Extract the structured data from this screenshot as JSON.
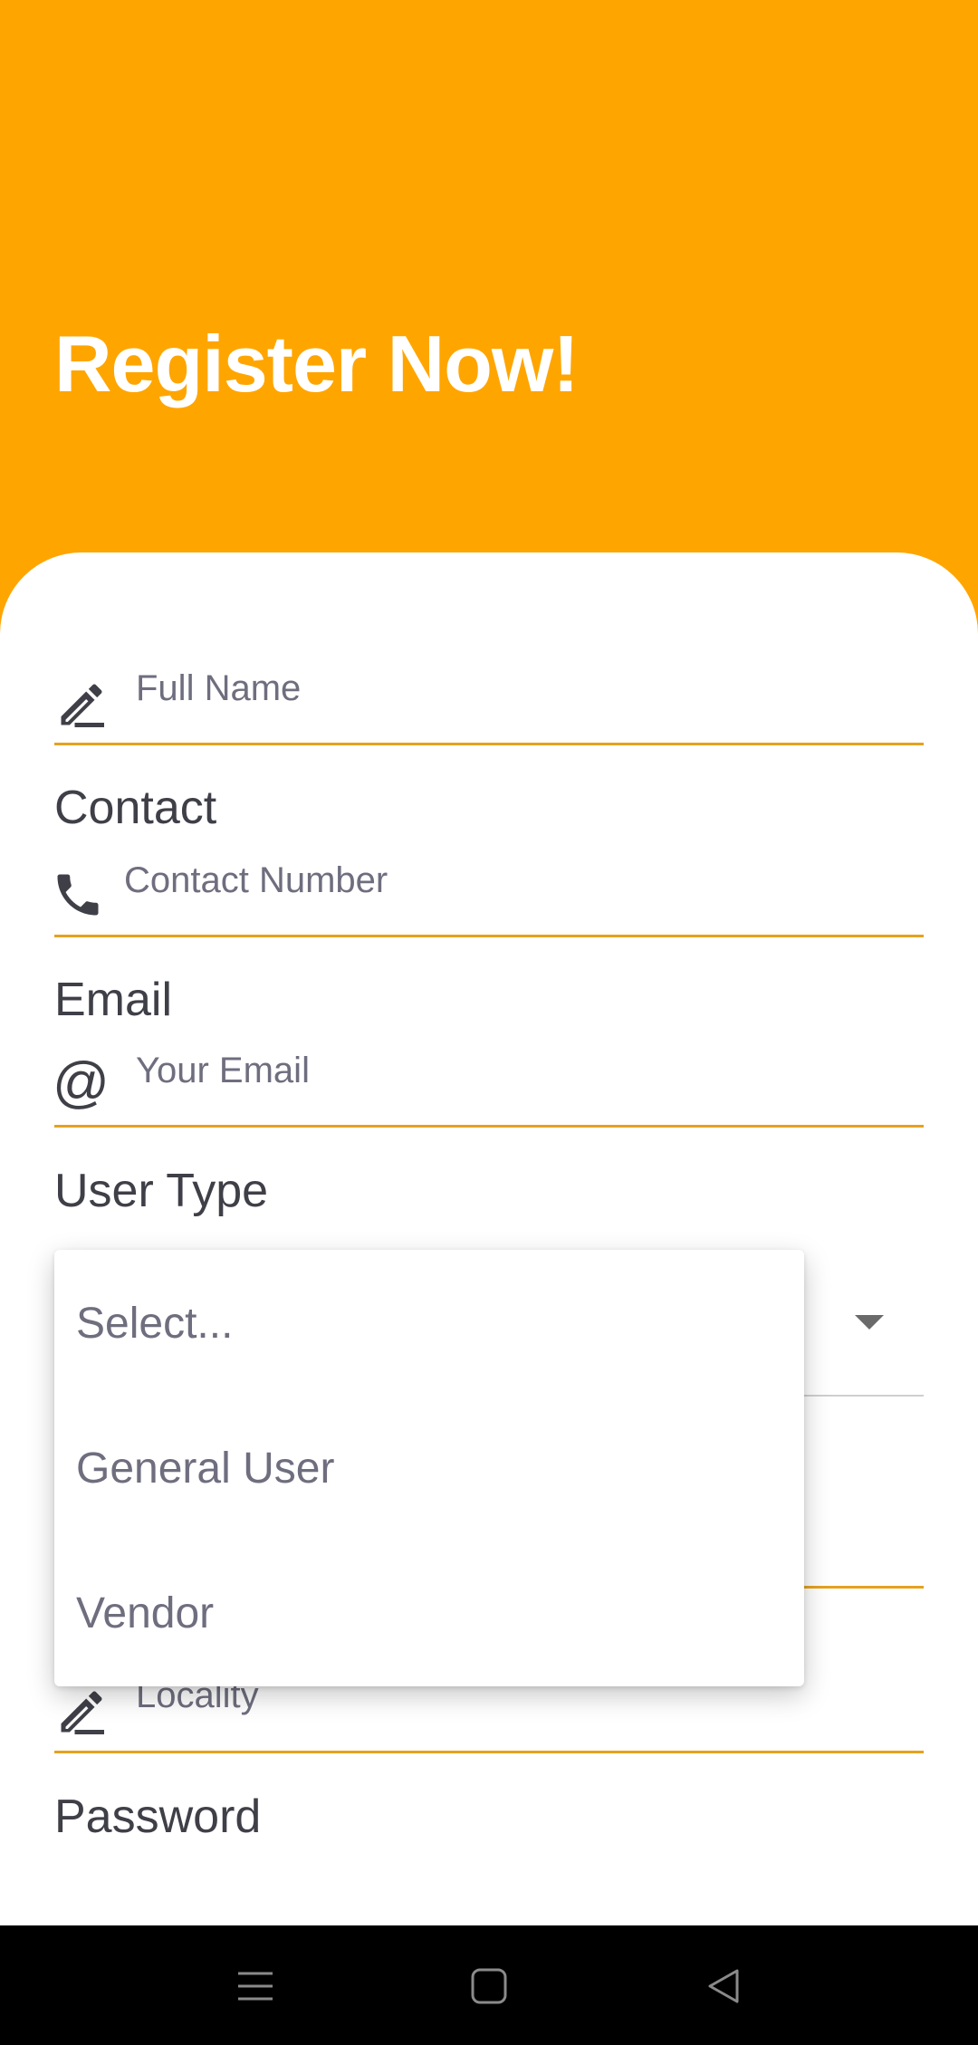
{
  "header": {
    "title": "Register Now!"
  },
  "form": {
    "full_name": {
      "placeholder": "Full Name"
    },
    "contact": {
      "label": "Contact",
      "placeholder": "Contact Number"
    },
    "email": {
      "label": "Email",
      "placeholder": "Your Email",
      "icon": "@"
    },
    "user_type": {
      "label": "User Type",
      "options": [
        "Select...",
        "General User",
        "Vendor"
      ]
    },
    "locality": {
      "placeholder": "Locality"
    },
    "password": {
      "label": "Password"
    }
  },
  "colors": {
    "accent": "#FFA500",
    "underline": "#e5a21f",
    "text": "#3f3f48",
    "placeholder": "#6e6e7f"
  },
  "navbar": {
    "icons": [
      "menu-icon",
      "home-icon",
      "back-icon"
    ]
  }
}
